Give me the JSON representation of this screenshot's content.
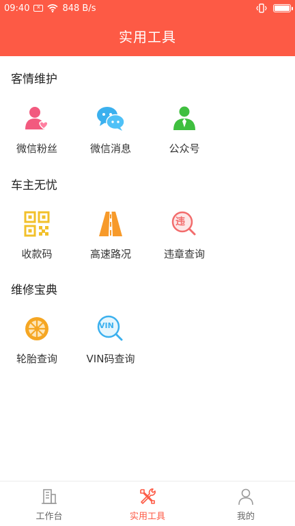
{
  "status_bar": {
    "time": "09:40",
    "notif_badge": "✕",
    "speed": "848 B/s"
  },
  "header": {
    "title": "实用工具"
  },
  "sections": [
    {
      "title": "客情维护",
      "items": [
        {
          "label": "微信粉丝",
          "icon": "user-heart-icon"
        },
        {
          "label": "微信消息",
          "icon": "chat-bubbles-icon"
        },
        {
          "label": "公众号",
          "icon": "official-account-icon"
        }
      ]
    },
    {
      "title": "车主无忧",
      "items": [
        {
          "label": "收款码",
          "icon": "qr-code-icon"
        },
        {
          "label": "高速路况",
          "icon": "highway-icon"
        },
        {
          "label": "违章查询",
          "icon": "violation-search-icon",
          "glyph": "违"
        }
      ]
    },
    {
      "title": "维修宝典",
      "items": [
        {
          "label": "轮胎查询",
          "icon": "tire-icon"
        },
        {
          "label": "VIN码查询",
          "icon": "vin-search-icon",
          "glyph": "VIN"
        }
      ]
    }
  ],
  "tabbar": {
    "items": [
      {
        "label": "工作台",
        "icon": "building-icon",
        "active": false
      },
      {
        "label": "实用工具",
        "icon": "tools-icon",
        "active": true
      },
      {
        "label": "我的",
        "icon": "person-icon",
        "active": false
      }
    ]
  },
  "colors": {
    "brand": "#fd5a45",
    "tab_inactive": "#999999"
  }
}
